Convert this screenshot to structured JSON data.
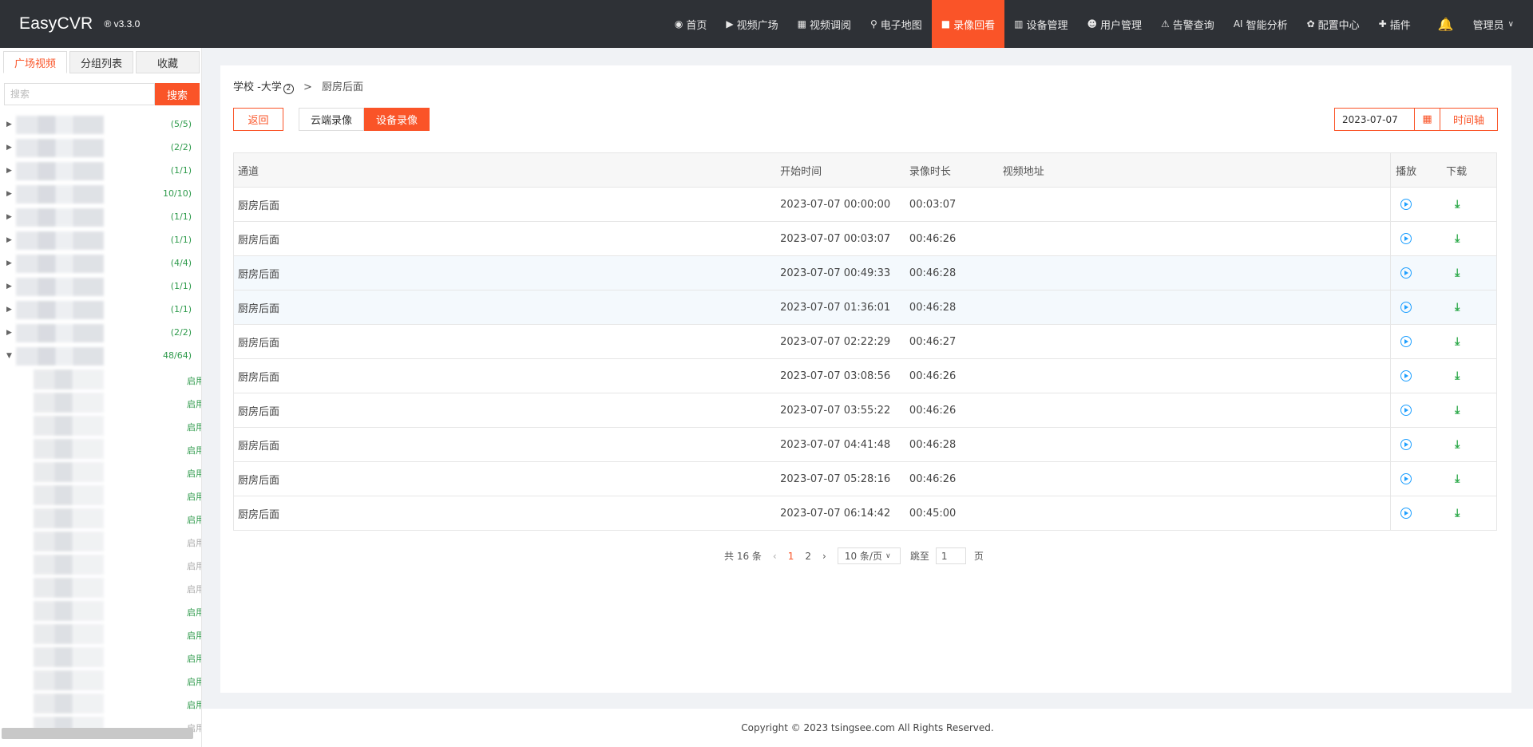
{
  "brand": {
    "name": "EasyCVR",
    "version": "® v3.3.0"
  },
  "nav": {
    "items": [
      {
        "icon": "◉",
        "label": "首页",
        "active": false
      },
      {
        "icon": "▶",
        "label": "视频广场",
        "active": false
      },
      {
        "icon": "▦",
        "label": "视频调阅",
        "active": false
      },
      {
        "icon": "⚲",
        "label": "电子地图",
        "active": false
      },
      {
        "icon": "■",
        "label": "录像回看",
        "active": true
      },
      {
        "icon": "▥",
        "label": "设备管理",
        "active": false
      },
      {
        "icon": "☻",
        "label": "用户管理",
        "active": false
      },
      {
        "icon": "⚠",
        "label": "告警查询",
        "active": false
      },
      {
        "icon": "AI",
        "label": "智能分析",
        "active": false
      },
      {
        "icon": "✿",
        "label": "配置中心",
        "active": false
      },
      {
        "icon": "✚",
        "label": "插件",
        "active": false
      }
    ],
    "bell": "🔔",
    "user": "管理员"
  },
  "sidebar": {
    "tabs": [
      {
        "label": "广场视频",
        "active": true
      },
      {
        "label": "分组列表",
        "active": false
      },
      {
        "label": "收藏",
        "active": false
      }
    ],
    "search_placeholder": "搜索",
    "search_button": "搜索",
    "tree": [
      {
        "count": "(5/5)"
      },
      {
        "count": "(2/2)"
      },
      {
        "count": "(1/1)"
      },
      {
        "count": "10/10)"
      },
      {
        "count": "(1/1)"
      },
      {
        "count": "(1/1)"
      },
      {
        "count": "(4/4)"
      },
      {
        "count": "(1/1)"
      },
      {
        "count": "(1/1)"
      },
      {
        "count": "(2/2)"
      },
      {
        "count": "48/64)"
      }
    ],
    "children": [
      {
        "label": "启用",
        "on": true
      },
      {
        "label": "启用",
        "on": true
      },
      {
        "label": "启用",
        "on": true
      },
      {
        "label": "启用",
        "on": true
      },
      {
        "label": "启用",
        "on": true
      },
      {
        "label": "启用",
        "on": true
      },
      {
        "label": "启用",
        "on": true
      },
      {
        "label": "启用",
        "on": false
      },
      {
        "label": "启用",
        "on": false
      },
      {
        "label": "启用",
        "on": false
      },
      {
        "label": "启用",
        "on": true
      },
      {
        "label": "启用",
        "on": true
      },
      {
        "label": "启用",
        "on": true
      },
      {
        "label": "启用",
        "on": true
      },
      {
        "label": "启用",
        "on": true
      },
      {
        "label": "启用",
        "on": false
      }
    ]
  },
  "breadcrumb": {
    "parent": "学校 -大学",
    "badge": "2",
    "separator": ">",
    "current": "厨房后面"
  },
  "toolbar": {
    "back": "返回",
    "cloud": "云端录像",
    "device": "设备录像",
    "date": "2023-07-07",
    "timeline": "时间轴"
  },
  "table": {
    "headers": [
      "通道",
      "开始时间",
      "录像时长",
      "视频地址",
      "播放",
      "下载"
    ],
    "rows": [
      {
        "channel": "厨房后面",
        "start": "2023-07-07 00:00:00",
        "duration": "00:03:07",
        "url": ""
      },
      {
        "channel": "厨房后面",
        "start": "2023-07-07 00:03:07",
        "duration": "00:46:26",
        "url": ""
      },
      {
        "channel": "厨房后面",
        "start": "2023-07-07 00:49:33",
        "duration": "00:46:28",
        "url": ""
      },
      {
        "channel": "厨房后面",
        "start": "2023-07-07 01:36:01",
        "duration": "00:46:28",
        "url": ""
      },
      {
        "channel": "厨房后面",
        "start": "2023-07-07 02:22:29",
        "duration": "00:46:27",
        "url": ""
      },
      {
        "channel": "厨房后面",
        "start": "2023-07-07 03:08:56",
        "duration": "00:46:26",
        "url": ""
      },
      {
        "channel": "厨房后面",
        "start": "2023-07-07 03:55:22",
        "duration": "00:46:26",
        "url": ""
      },
      {
        "channel": "厨房后面",
        "start": "2023-07-07 04:41:48",
        "duration": "00:46:28",
        "url": ""
      },
      {
        "channel": "厨房后面",
        "start": "2023-07-07 05:28:16",
        "duration": "00:46:26",
        "url": ""
      },
      {
        "channel": "厨房后面",
        "start": "2023-07-07 06:14:42",
        "duration": "00:45:00",
        "url": ""
      }
    ]
  },
  "pager": {
    "total": "共 16 条",
    "prev": "‹",
    "pages": [
      "1",
      "2"
    ],
    "next": "›",
    "size": "10 条/页",
    "jump_label": "跳至",
    "jump_value": "1",
    "page_unit": "页"
  },
  "footer": {
    "copyright": "Copyright © 2023 tsingsee.com All Rights Reserved."
  },
  "colors": {
    "accent": "#fa5428",
    "header": "#2e3136",
    "play": "#1e9fff",
    "download": "#2eaa4b"
  }
}
